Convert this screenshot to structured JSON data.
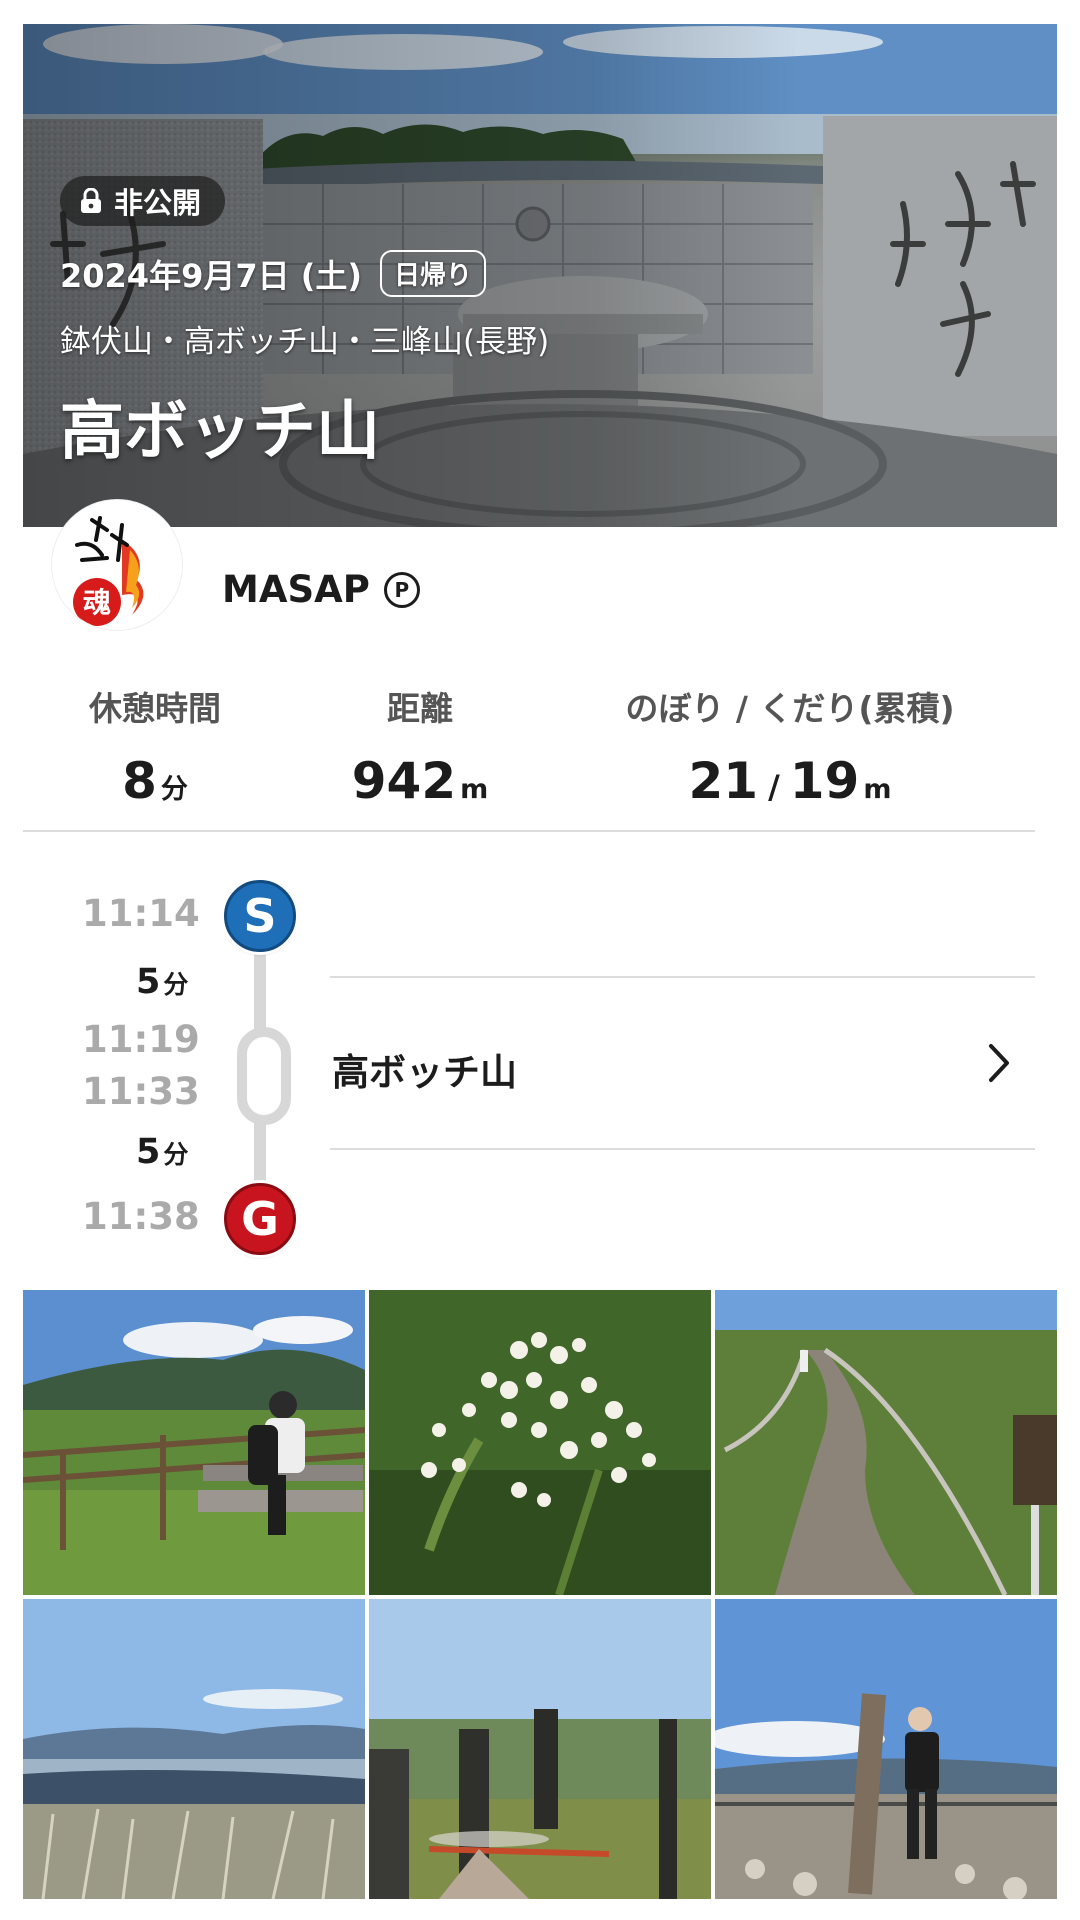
{
  "header": {
    "visibility_label": "非公開",
    "date": "2024年9月7日 (土)",
    "trip_type": "日帰り",
    "area": "鉢伏山・高ボッチ山・三峰山(長野)",
    "title": "高ボッチ山"
  },
  "user": {
    "name": "MASAP",
    "badge": "P"
  },
  "stats": [
    {
      "label": "休憩時間",
      "value": "8",
      "unit": "分"
    },
    {
      "label": "距離",
      "value": "942",
      "unit": "m"
    },
    {
      "label": "のぼり / くだり(累積)",
      "value_up": "21",
      "sep": "/",
      "value_down": "19",
      "unit": "m"
    }
  ],
  "timeline": {
    "start_time": "11:14",
    "start_label": "S",
    "leg1_duration": "5",
    "leg1_unit": "分",
    "waypoint_arrive": "11:19",
    "waypoint_depart": "11:33",
    "waypoint_name": "高ボッチ山",
    "leg2_duration": "5",
    "leg2_unit": "分",
    "goal_time": "11:38",
    "goal_label": "G"
  },
  "colors": {
    "start_node": "#1e6fb8",
    "goal_node": "#c8141e",
    "time_gray": "#aaaaaa"
  },
  "icons": {
    "private": "lock-icon",
    "waypoint_open": "chevron-right-icon"
  },
  "photos_count": 6
}
